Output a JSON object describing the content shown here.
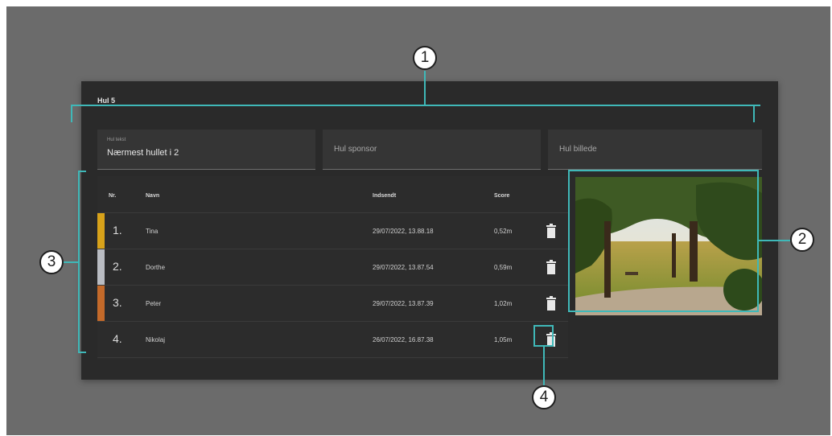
{
  "card": {
    "title": "Hul 5"
  },
  "fields": {
    "hole_text": {
      "label": "Hul tekst",
      "value": "Nærmest hullet i 2"
    },
    "hole_sponsor": {
      "placeholder": "Hul sponsor"
    },
    "hole_image": {
      "placeholder": "Hul billede"
    }
  },
  "table": {
    "headers": {
      "nr": "Nr.",
      "name": "Navn",
      "submitted": "Indsendt",
      "score": "Score"
    },
    "rows": [
      {
        "rank": "1.",
        "name": "Tina",
        "submitted": "29/07/2022, 13.88.18",
        "score": "0,52m",
        "medal_color": "#d8a21a"
      },
      {
        "rank": "2.",
        "name": "Dorthe",
        "submitted": "29/07/2022, 13.87.54",
        "score": "0,59m",
        "medal_color": "#b9bcc2"
      },
      {
        "rank": "3.",
        "name": "Peter",
        "submitted": "29/07/2022, 13.87.39",
        "score": "1,02m",
        "medal_color": "#c46a2a"
      },
      {
        "rank": "4.",
        "name": "Nikolaj",
        "submitted": "26/07/2022, 16.87.38",
        "score": "1,05m",
        "medal_color": ""
      }
    ]
  },
  "annotations": {
    "marker_1": "1",
    "marker_2": "2",
    "marker_3": "3",
    "marker_4": "4",
    "accent_color": "#3fb8b8"
  }
}
